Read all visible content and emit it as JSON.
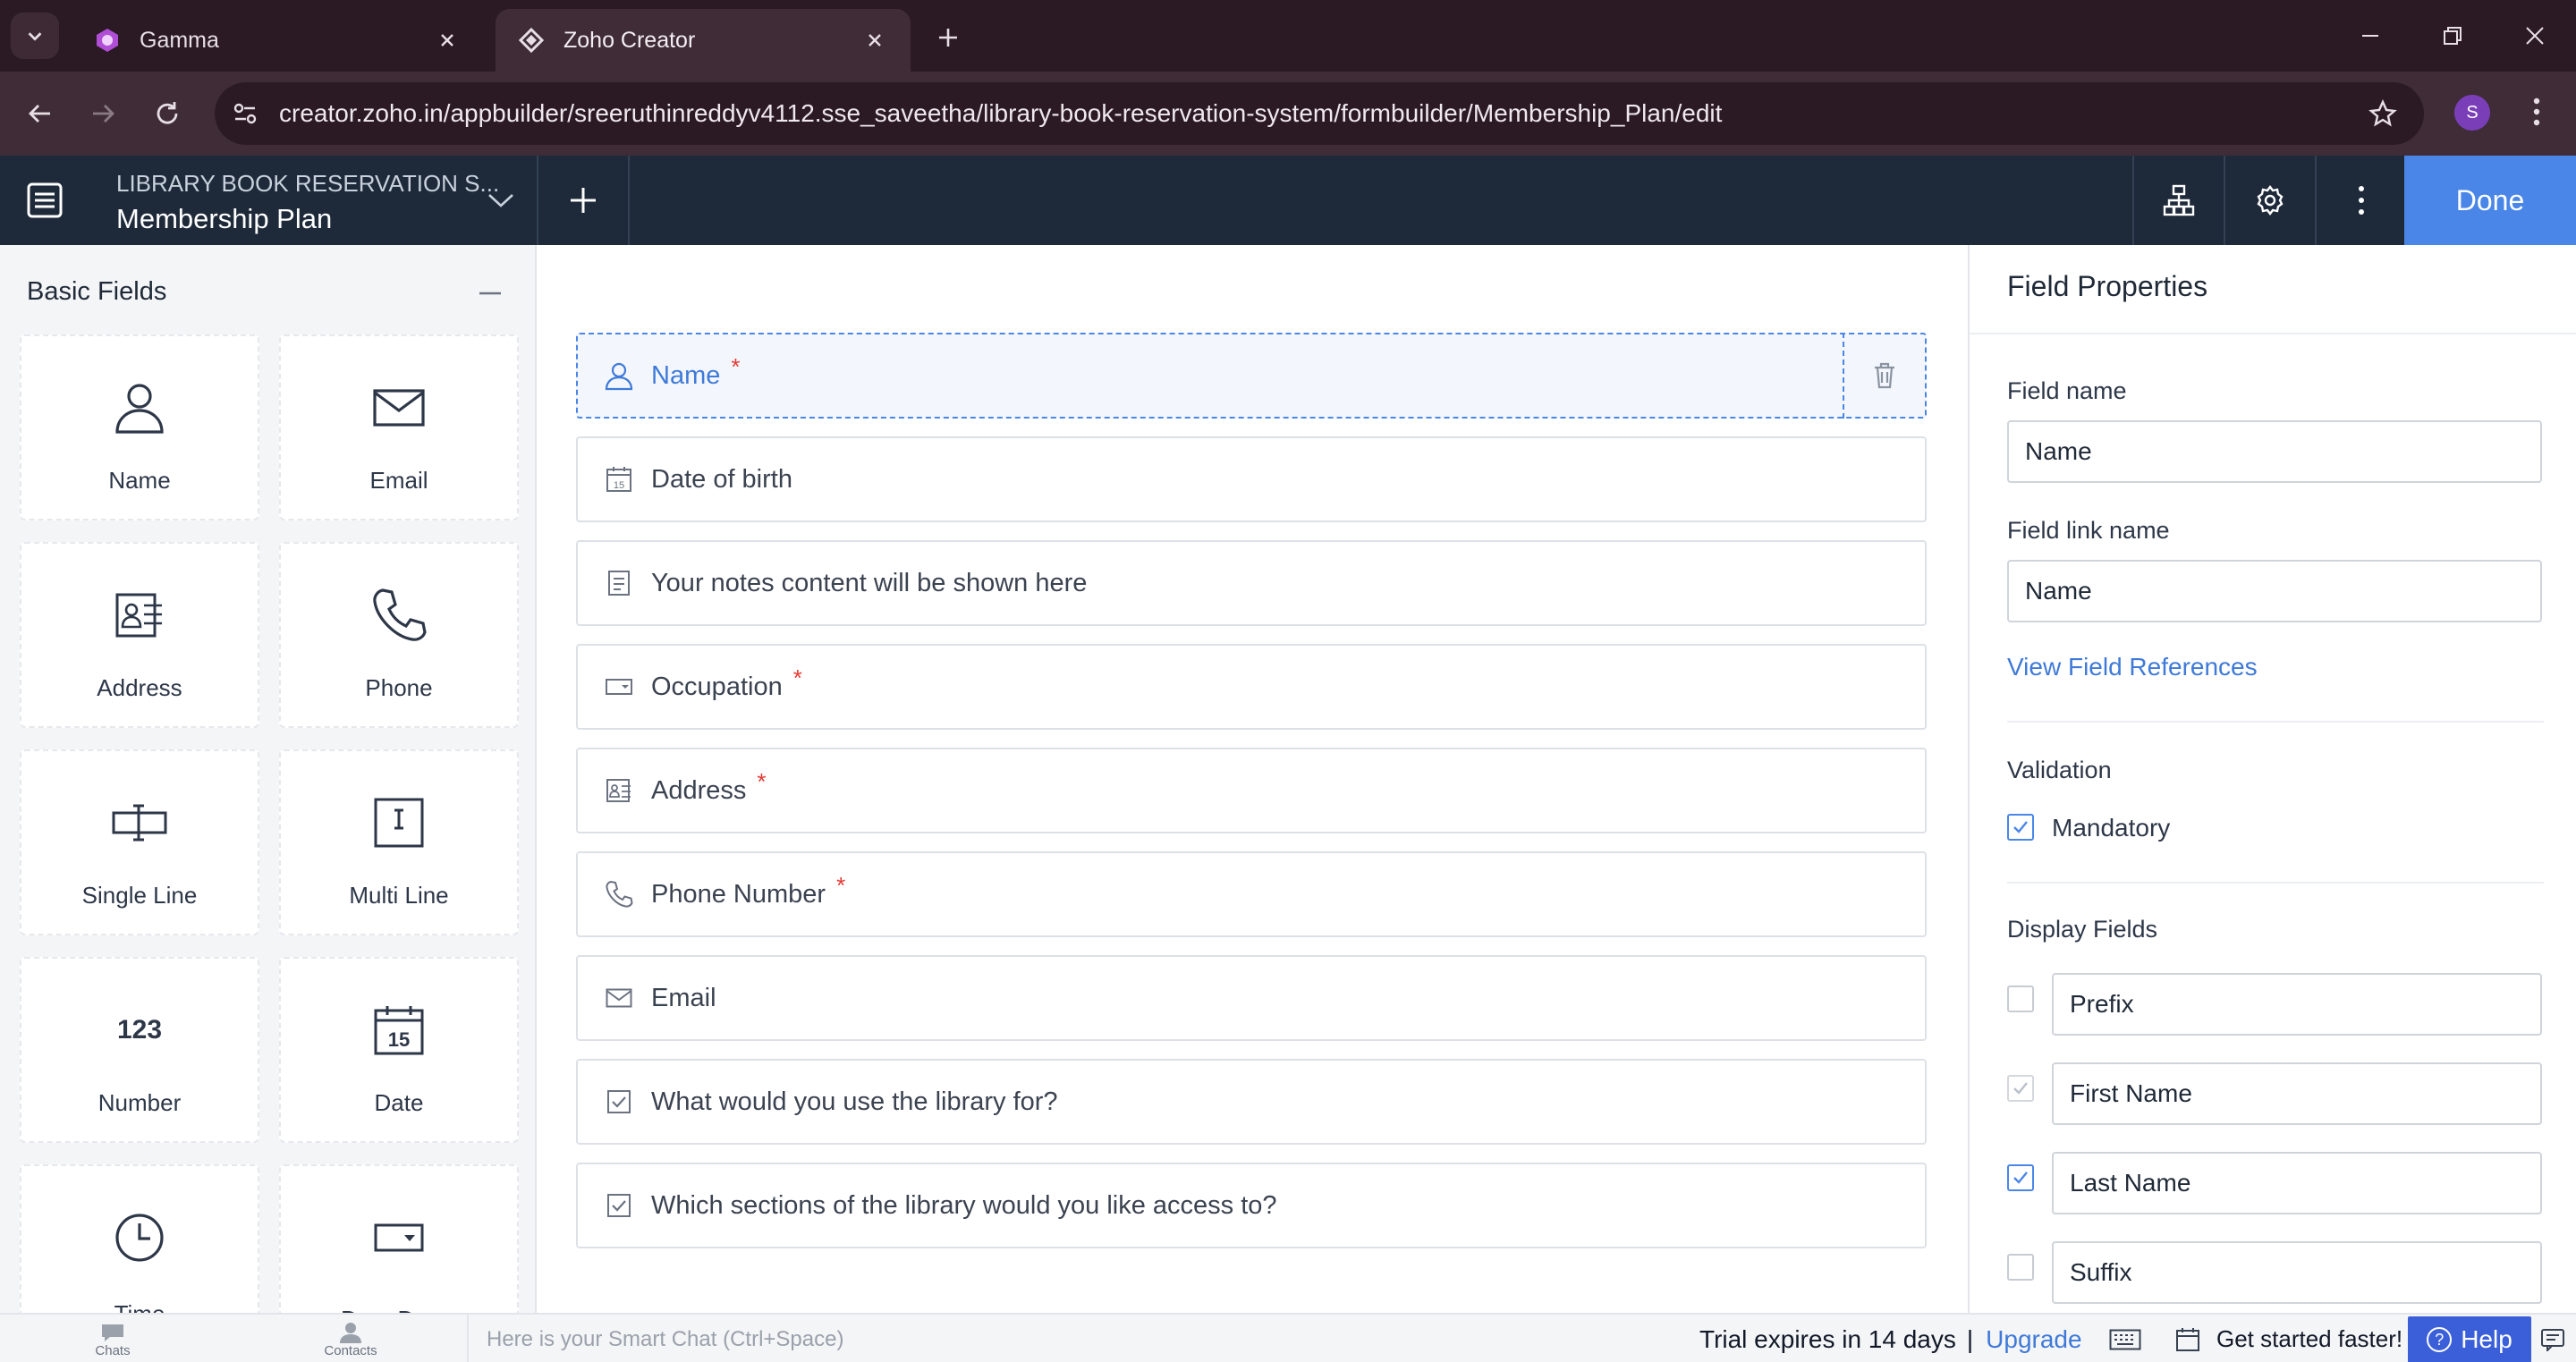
{
  "browser": {
    "tabs": [
      {
        "title": "Gamma",
        "active": false
      },
      {
        "title": "Zoho Creator",
        "active": true
      }
    ],
    "url": "creator.zoho.in/appbuilder/sreeruthinreddyv4112.sse_saveetha/library-book-reservation-system/formbuilder/Membership_Plan/edit",
    "profile_initial": "S"
  },
  "header": {
    "app_name": "LIBRARY BOOK RESERVATION S...",
    "form_name": "Membership Plan",
    "done_label": "Done",
    "icons": [
      "app-menu-icon",
      "chevron-down-icon",
      "plus-icon",
      "hierarchy-icon",
      "gear-icon",
      "kebab-icon"
    ]
  },
  "palette": {
    "title": "Basic Fields",
    "fields": [
      {
        "label": "Name",
        "icon": "person-icon"
      },
      {
        "label": "Email",
        "icon": "envelope-icon"
      },
      {
        "label": "Address",
        "icon": "address-card-icon"
      },
      {
        "label": "Phone",
        "icon": "phone-icon"
      },
      {
        "label": "Single Line",
        "icon": "single-line-icon"
      },
      {
        "label": "Multi Line",
        "icon": "multi-line-icon"
      },
      {
        "label": "Number",
        "icon": "number-icon",
        "glyph": "123"
      },
      {
        "label": "Date",
        "icon": "calendar-icon",
        "glyph": "15"
      },
      {
        "label": "Time",
        "icon": "clock-icon"
      },
      {
        "label": "Drop Down",
        "icon": "dropdown-icon"
      }
    ]
  },
  "form": {
    "rows": [
      {
        "label": "Name",
        "icon": "person-icon",
        "required": true,
        "selected": true
      },
      {
        "label": "Date of birth",
        "icon": "calendar-icon",
        "required": false
      },
      {
        "label": "Your notes content will be shown here",
        "icon": "notes-icon",
        "required": false
      },
      {
        "label": "Occupation",
        "icon": "dropdown-icon",
        "required": true
      },
      {
        "label": "Address",
        "icon": "address-card-icon",
        "required": true
      },
      {
        "label": "Phone Number",
        "icon": "phone-icon",
        "required": true
      },
      {
        "label": "Email",
        "icon": "envelope-icon",
        "required": false
      },
      {
        "label": "What would you use the library for?",
        "icon": "checkbox-icon",
        "required": false
      },
      {
        "label": "Which sections of the library would you like access to?",
        "icon": "checkbox-icon",
        "required": false
      }
    ],
    "required_mark": "*"
  },
  "properties": {
    "title": "Field Properties",
    "field_name_label": "Field name",
    "field_name_value": "Name",
    "field_link_label": "Field link name",
    "field_link_value": "Name",
    "view_references": "View Field References",
    "validation_label": "Validation",
    "mandatory_label": "Mandatory",
    "mandatory_checked": true,
    "display_fields_label": "Display Fields",
    "display_fields": [
      {
        "label": "Prefix",
        "checked": false,
        "disabled": false
      },
      {
        "label": "First Name",
        "checked": true,
        "disabled": true
      },
      {
        "label": "Last Name",
        "checked": true,
        "disabled": false
      },
      {
        "label": "Suffix",
        "checked": false,
        "disabled": false
      }
    ]
  },
  "bottombar": {
    "chats": "Chats",
    "contacts": "Contacts",
    "smart_chat_placeholder": "Here is your Smart Chat (Ctrl+Space)",
    "trial_text": "Trial expires in 14 days",
    "separator": "|",
    "upgrade": "Upgrade",
    "get_started": "Get started faster!",
    "help": "Help"
  },
  "colors": {
    "accent": "#4a86e8",
    "header_bg": "#1e2a3a",
    "browser_bg": "#2b1a24",
    "required": "#e53935"
  }
}
